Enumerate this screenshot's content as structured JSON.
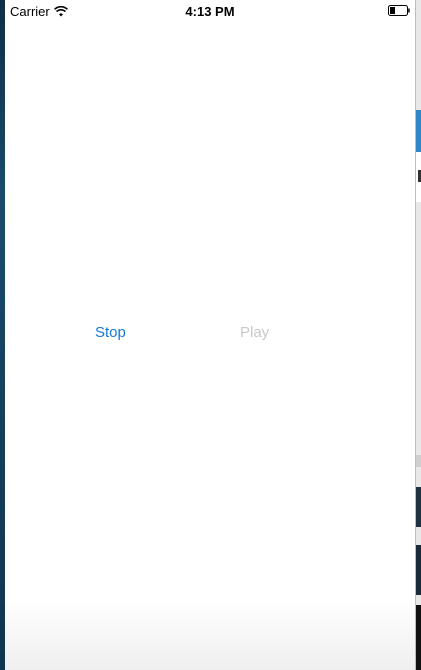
{
  "status_bar": {
    "carrier": "Carrier",
    "time": "4:13 PM",
    "icons": [
      "wifi-icon",
      "battery-icon"
    ]
  },
  "controls": {
    "stop_label": "Stop",
    "play_label": "Play",
    "play_enabled": false
  },
  "colors": {
    "accent": "#1479d8",
    "disabled": "#c8c8c8",
    "background": "#ffffff"
  }
}
